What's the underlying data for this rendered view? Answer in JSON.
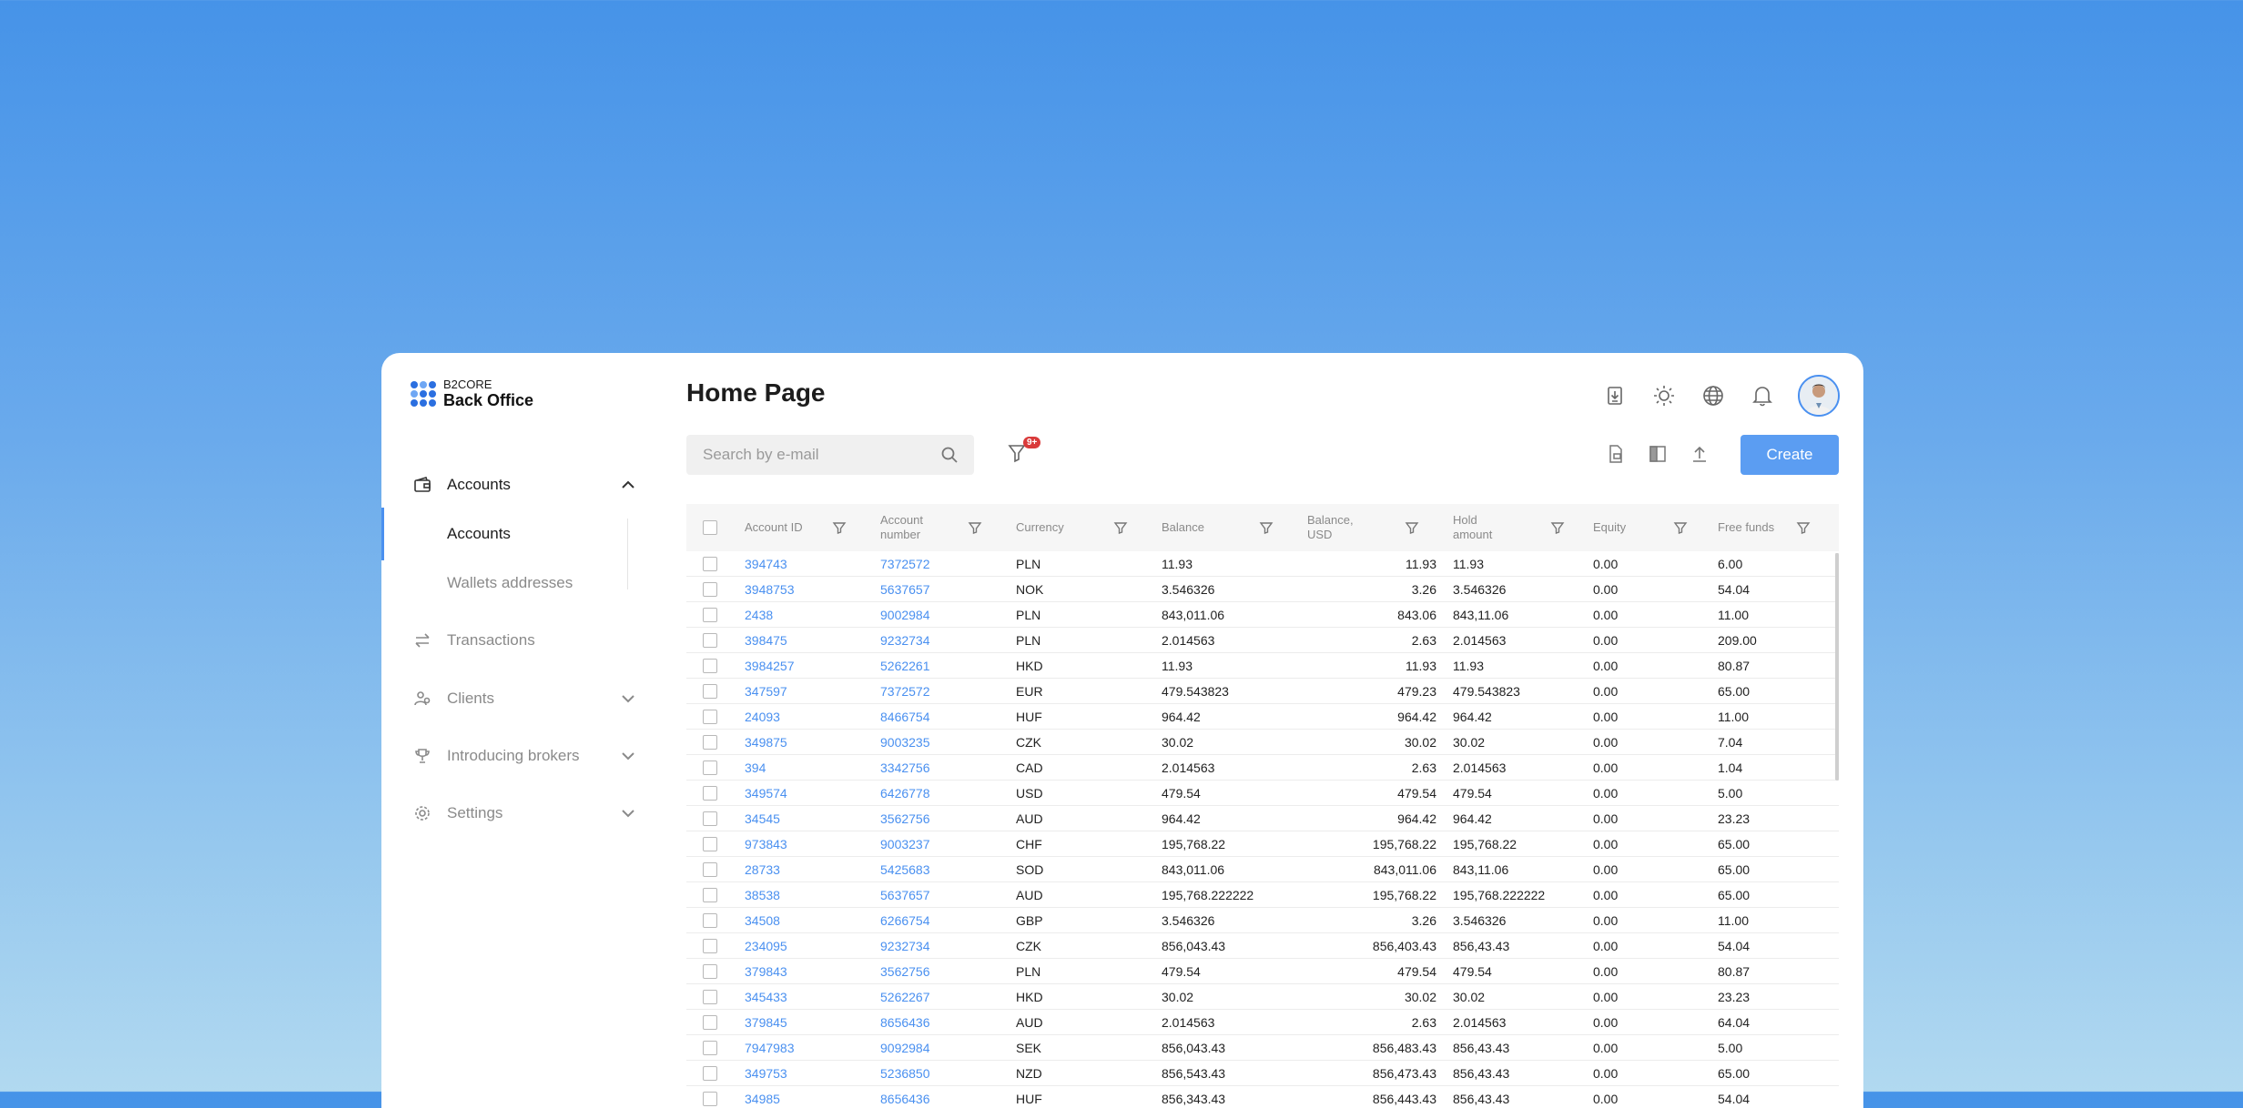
{
  "brand": {
    "small": "B2CORE",
    "big": "Back Office"
  },
  "sidebar": {
    "items": [
      {
        "label": "Accounts",
        "icon": "wallet-icon"
      },
      {
        "label": "Transactions",
        "icon": "transfer-icon"
      },
      {
        "label": "Clients",
        "icon": "users-icon"
      },
      {
        "label": "Introducing brokers",
        "icon": "trophy-icon"
      },
      {
        "label": "Settings",
        "icon": "gear-icon"
      }
    ],
    "sub_items": [
      {
        "label": "Accounts"
      },
      {
        "label": "Wallets addresses"
      }
    ]
  },
  "header": {
    "title": "Home Page"
  },
  "search": {
    "placeholder": "Search by e-mail"
  },
  "filter": {
    "badge": "9+"
  },
  "toolbar": {
    "create_label": "Create"
  },
  "colors": {
    "accent": "#4a90f0",
    "button": "#5b9df2",
    "badge": "#d93a3a"
  },
  "table": {
    "columns": [
      "Account ID",
      "Account number",
      "Currency",
      "Balance",
      "Balance, USD",
      "Hold amount",
      "Equity",
      "Free funds"
    ],
    "rows": [
      [
        "394743",
        "7372572",
        "PLN",
        "11.93",
        "11.93",
        "11.93",
        "0.00",
        "6.00"
      ],
      [
        "3948753",
        "5637657",
        "NOK",
        "3.546326",
        "3.26",
        "3.546326",
        "0.00",
        "54.04"
      ],
      [
        "2438",
        "9002984",
        "PLN",
        "843,011.06",
        "843.06",
        "843,11.06",
        "0.00",
        "11.00"
      ],
      [
        "398475",
        "9232734",
        "PLN",
        "2.014563",
        "2.63",
        "2.014563",
        "0.00",
        "209.00"
      ],
      [
        "3984257",
        "5262261",
        "HKD",
        "11.93",
        "11.93",
        "11.93",
        "0.00",
        "80.87"
      ],
      [
        "347597",
        "7372572",
        "EUR",
        "479.543823",
        "479.23",
        "479.543823",
        "0.00",
        "65.00"
      ],
      [
        "24093",
        "8466754",
        "HUF",
        "964.42",
        "964.42",
        "964.42",
        "0.00",
        "11.00"
      ],
      [
        "349875",
        "9003235",
        "CZK",
        "30.02",
        "30.02",
        "30.02",
        "0.00",
        "7.04"
      ],
      [
        "394",
        "3342756",
        "CAD",
        "2.014563",
        "2.63",
        "2.014563",
        "0.00",
        "1.04"
      ],
      [
        "349574",
        "6426778",
        "USD",
        "479.54",
        "479.54",
        "479.54",
        "0.00",
        "5.00"
      ],
      [
        "34545",
        "3562756",
        "AUD",
        "964.42",
        "964.42",
        "964.42",
        "0.00",
        "23.23"
      ],
      [
        "973843",
        "9003237",
        "CHF",
        "195,768.22",
        "195,768.22",
        "195,768.22",
        "0.00",
        "65.00"
      ],
      [
        "28733",
        "5425683",
        "SOD",
        "843,011.06",
        "843,011.06",
        "843,11.06",
        "0.00",
        "65.00"
      ],
      [
        "38538",
        "5637657",
        "AUD",
        "195,768.222222",
        "195,768.22",
        "195,768.222222",
        "0.00",
        "65.00"
      ],
      [
        "34508",
        "6266754",
        "GBP",
        "3.546326",
        "3.26",
        "3.546326",
        "0.00",
        "11.00"
      ],
      [
        "234095",
        "9232734",
        "CZK",
        "856,043.43",
        "856,403.43",
        "856,43.43",
        "0.00",
        "54.04"
      ],
      [
        "379843",
        "3562756",
        "PLN",
        "479.54",
        "479.54",
        "479.54",
        "0.00",
        "80.87"
      ],
      [
        "345433",
        "5262267",
        "HKD",
        "30.02",
        "30.02",
        "30.02",
        "0.00",
        "23.23"
      ],
      [
        "379845",
        "8656436",
        "AUD",
        "2.014563",
        "2.63",
        "2.014563",
        "0.00",
        "64.04"
      ],
      [
        "7947983",
        "9092984",
        "SEK",
        "856,043.43",
        "856,483.43",
        "856,43.43",
        "0.00",
        "5.00"
      ],
      [
        "349753",
        "5236850",
        "NZD",
        "856,543.43",
        "856,473.43",
        "856,43.43",
        "0.00",
        "65.00"
      ],
      [
        "34985",
        "8656436",
        "HUF",
        "856,343.43",
        "856,443.43",
        "856,43.43",
        "0.00",
        "54.04"
      ]
    ]
  }
}
